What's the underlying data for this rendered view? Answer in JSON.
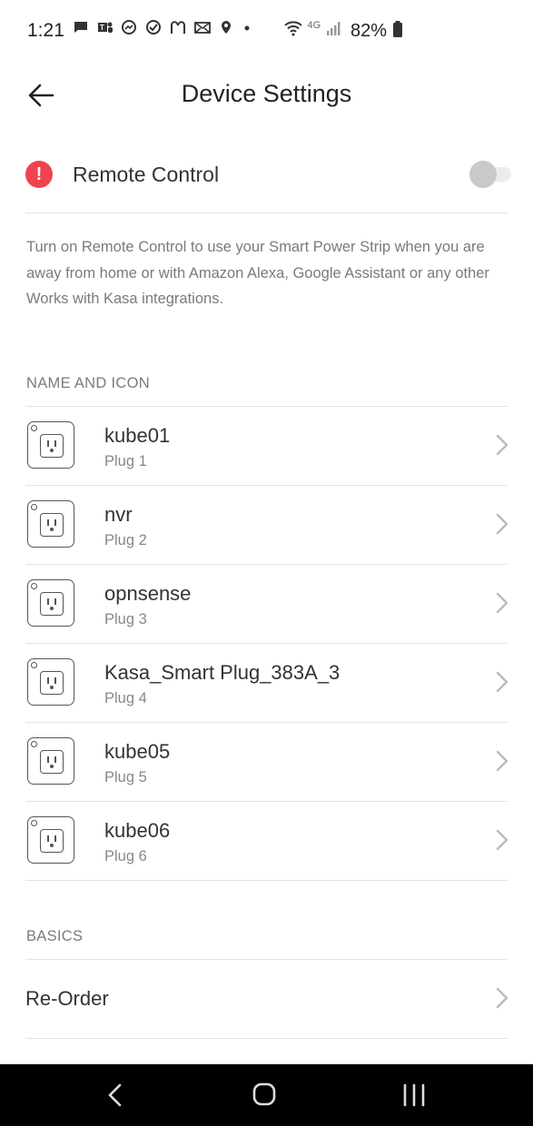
{
  "status_bar": {
    "time": "1:21",
    "left_icons": [
      "message-icon",
      "teams-icon",
      "messenger-icon",
      "check-circle-icon",
      "mcdonalds-icon",
      "mail-icon",
      "location-icon",
      "dot-icon"
    ],
    "network": "4G",
    "battery": "82%"
  },
  "header": {
    "title": "Device Settings"
  },
  "remote_control": {
    "label": "Remote Control",
    "enabled": false,
    "description": "Turn on Remote Control to use your Smart Power Strip when you are away from home or with Amazon Alexa, Google Assistant or any other Works with Kasa integrations."
  },
  "name_and_icon": {
    "section_title": "NAME AND ICON",
    "plugs": [
      {
        "name": "kube01",
        "sub": "Plug 1"
      },
      {
        "name": "nvr",
        "sub": "Plug 2"
      },
      {
        "name": "opnsense",
        "sub": "Plug 3"
      },
      {
        "name": "Kasa_Smart Plug_383A_3",
        "sub": "Plug 4"
      },
      {
        "name": "kube05",
        "sub": "Plug 5"
      },
      {
        "name": "kube06",
        "sub": "Plug 6"
      }
    ]
  },
  "basics": {
    "section_title": "BASICS",
    "items": [
      {
        "label": "Re-Order"
      }
    ]
  },
  "colors": {
    "alert": "#f0434e",
    "text_primary": "#333333",
    "text_secondary": "#7a7a7a",
    "divider": "#e4e4e4",
    "nav_bar": "#000000"
  }
}
